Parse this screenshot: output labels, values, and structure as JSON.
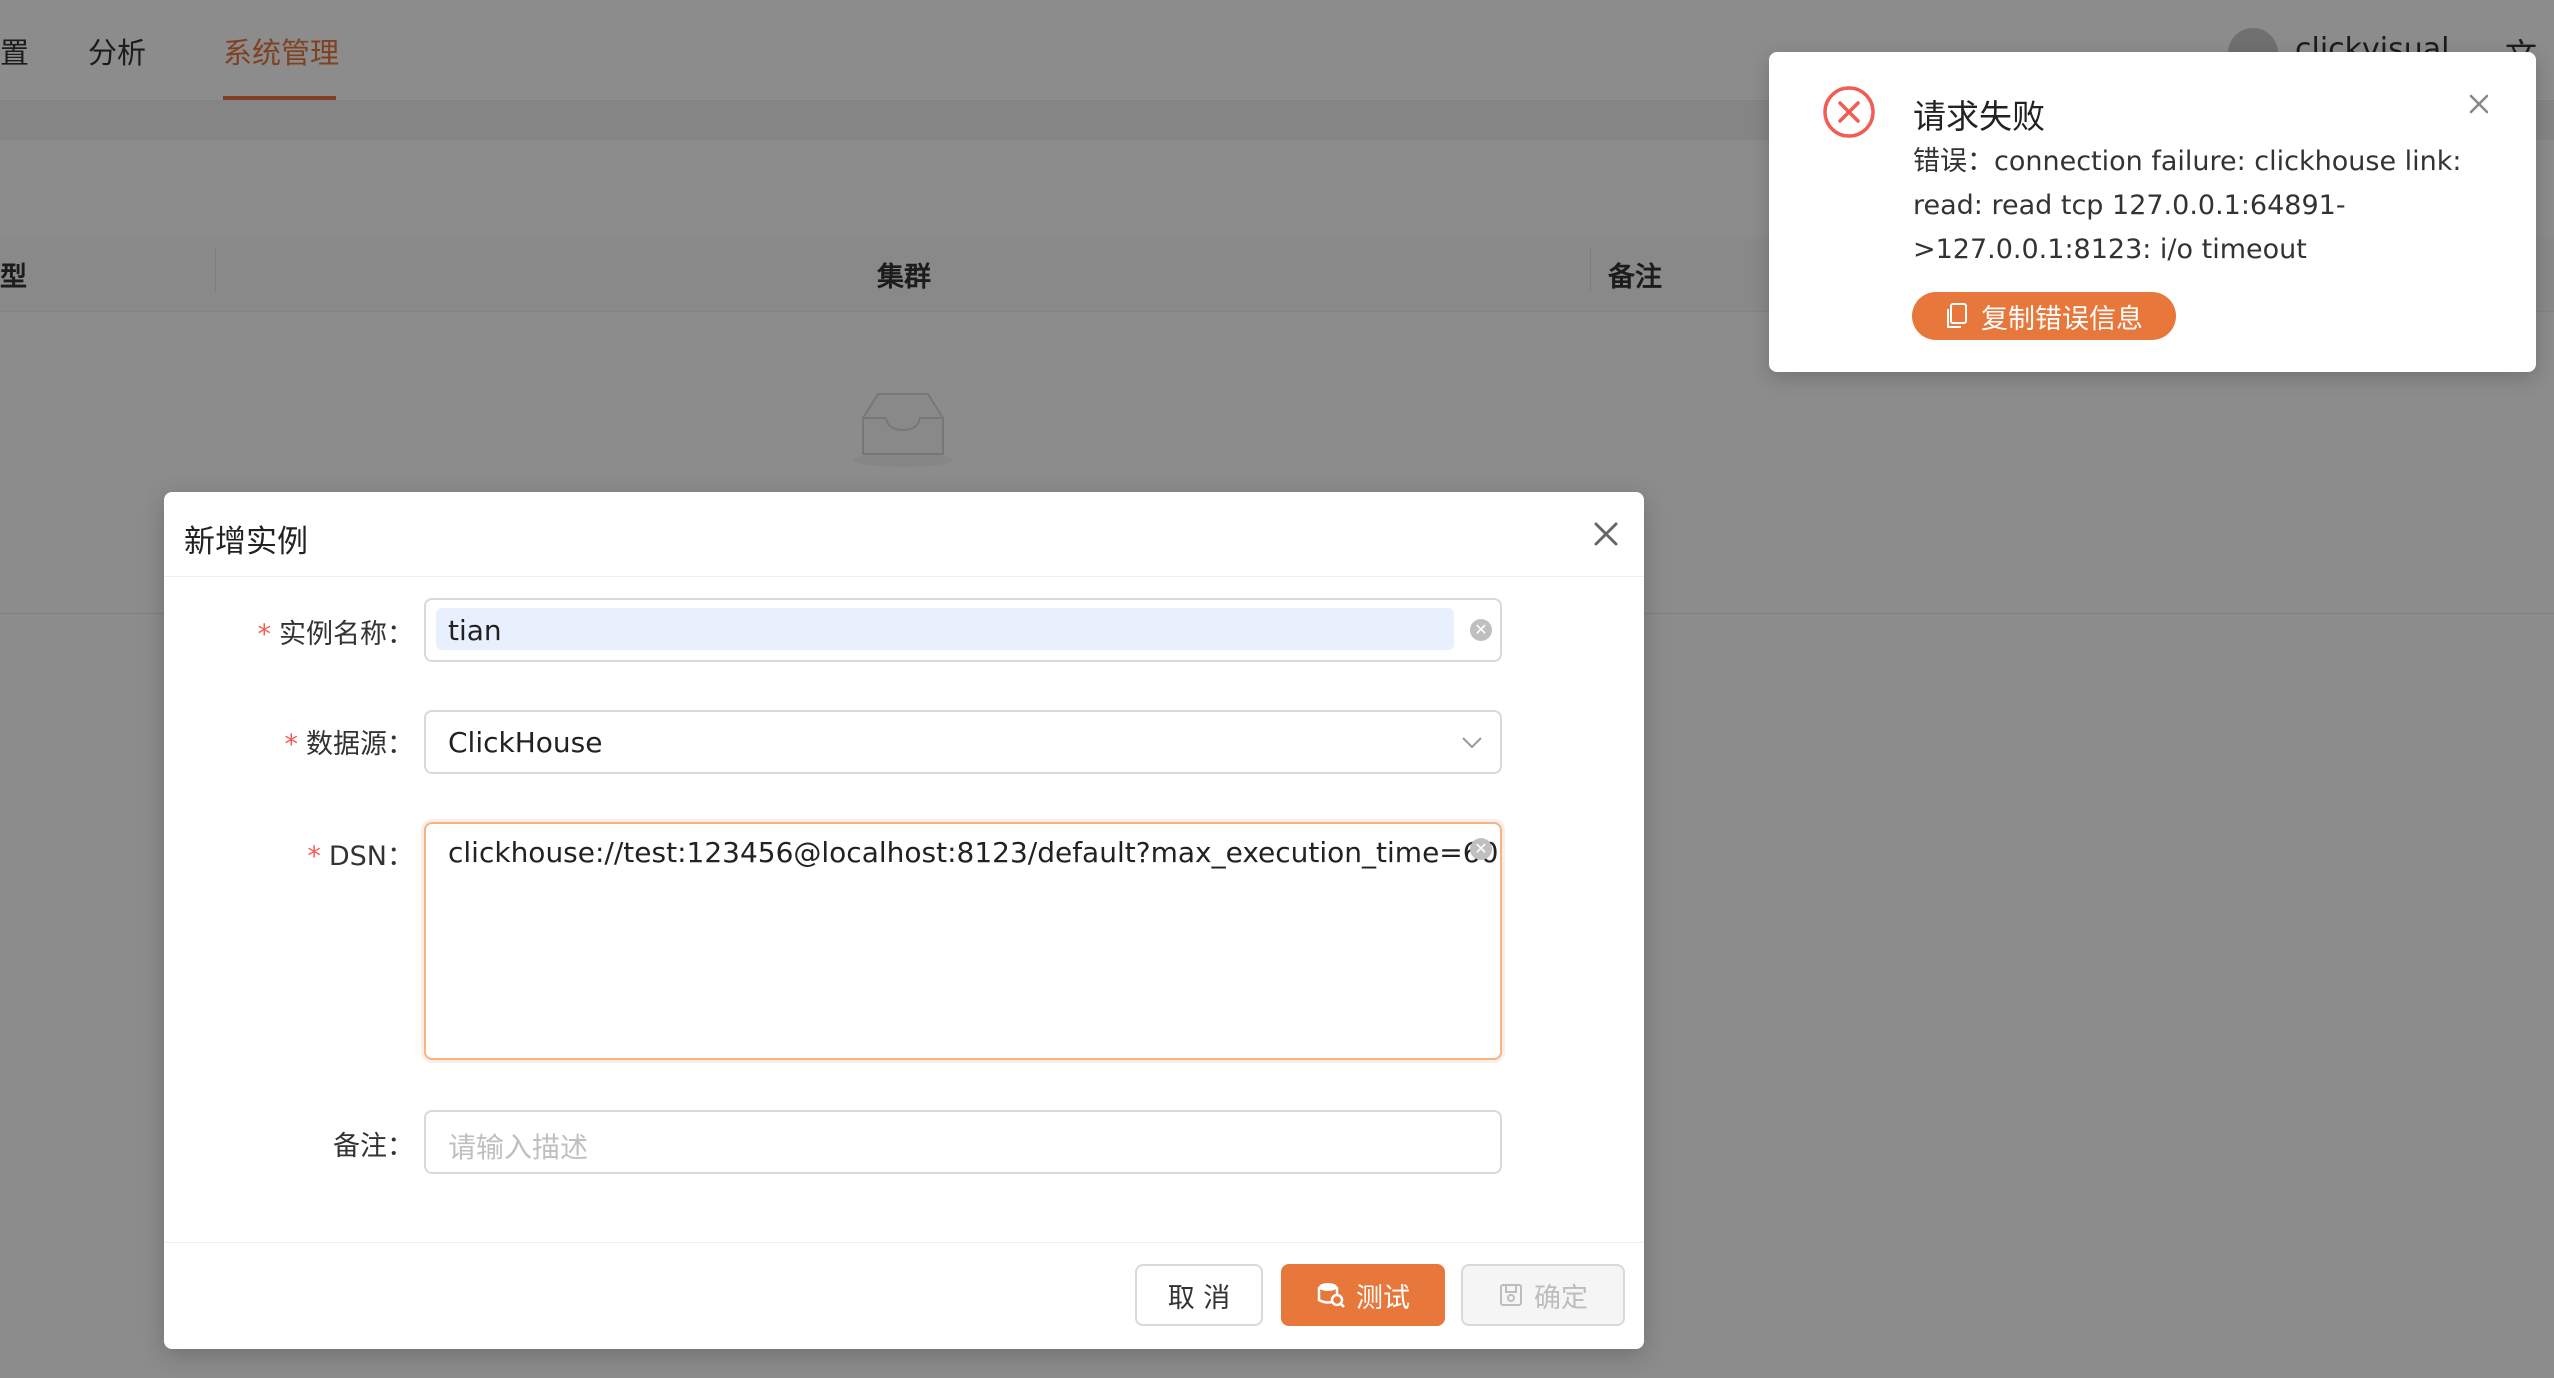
{
  "nav": {
    "partial_left": "置",
    "items": [
      {
        "label": "分析",
        "active": false
      },
      {
        "label": "系统管理",
        "active": true
      }
    ],
    "username": "clickvisual",
    "lang_glyph": "文"
  },
  "table": {
    "columns": [
      "型",
      "集群",
      "备注"
    ]
  },
  "modal": {
    "title": "新增实例",
    "fields": {
      "name": {
        "label": "实例名称：",
        "value": "tian",
        "required": true
      },
      "datasource": {
        "label": "数据源：",
        "value": "ClickHouse",
        "required": true
      },
      "dsn": {
        "label": "DSN：",
        "value": "clickhouse://test:123456@localhost:8123/default?max_execution_time=60",
        "required": true
      },
      "desc": {
        "label": "备注：",
        "placeholder": "请输入描述",
        "value": "",
        "required": false
      }
    },
    "buttons": {
      "cancel": "取 消",
      "test": "测试",
      "ok": "确定"
    }
  },
  "notification": {
    "title": "请求失败",
    "message_lines": [
      "错误：connection failure: clickhouse link:",
      "read: read tcp 127.0.0.1:64891-",
      ">127.0.0.1:8123: i/o timeout"
    ],
    "copy_button": "复制错误信息"
  },
  "colors": {
    "accent": "#e8773c",
    "error": "#f25c54",
    "mask": "rgba(0,0,0,0.45)"
  }
}
